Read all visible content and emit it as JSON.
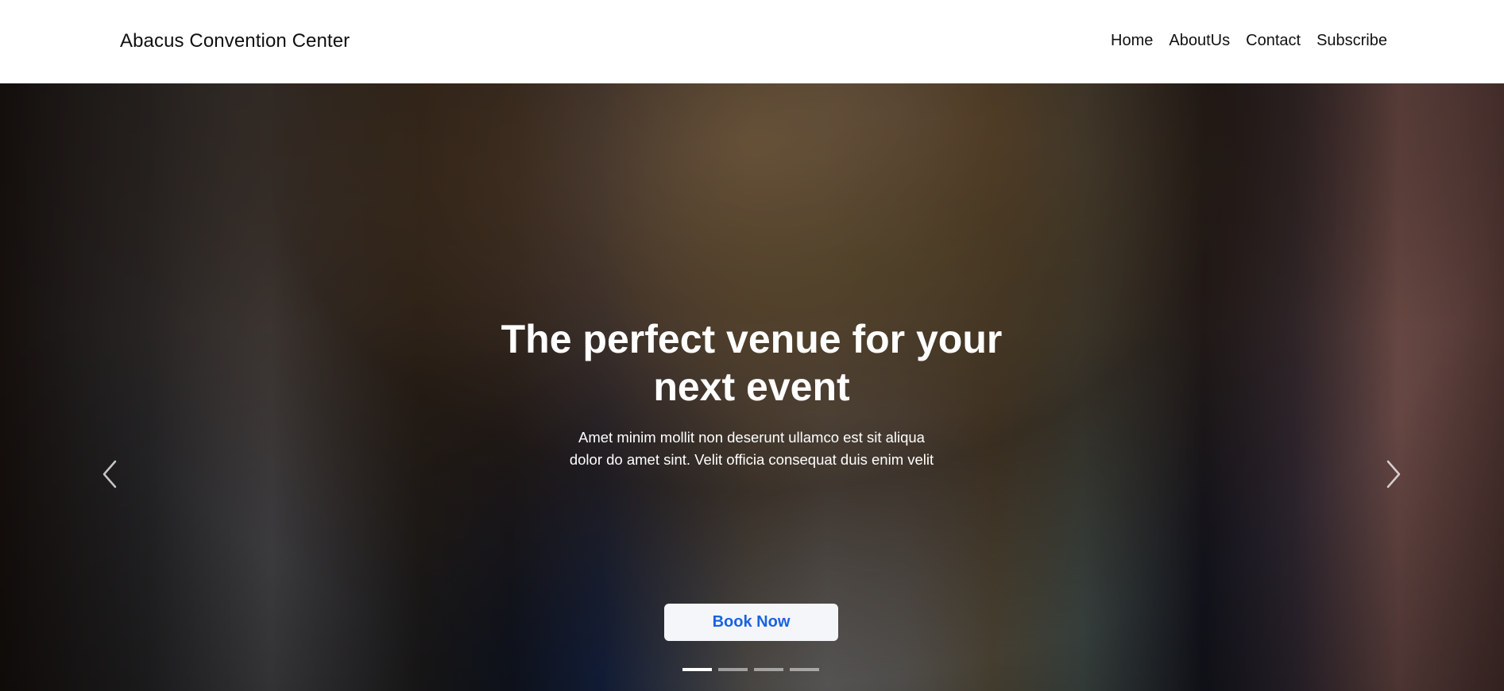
{
  "brand": {
    "name": "Abacus Convention Center"
  },
  "nav": {
    "items": [
      {
        "label": "Home"
      },
      {
        "label": "AboutUs"
      },
      {
        "label": "Contact"
      },
      {
        "label": "Subscribe"
      }
    ]
  },
  "hero": {
    "headline_line1": "The perfect venue for your",
    "headline_line2": "next event",
    "subtext_line1": "Amet minim mollit non deserunt ullamco est sit aliqua",
    "subtext_line2": "dolor do amet sint. Velit officia consequat duis enim velit",
    "cta_label": "Book Now",
    "prev_icon": "chevron-left-icon",
    "next_icon": "chevron-right-icon",
    "slide_count": 4,
    "active_slide": 1
  },
  "colors": {
    "cta_text": "#1b63de",
    "cta_bg": "#f4f6fa",
    "navbar_bg": "#ffffff"
  }
}
